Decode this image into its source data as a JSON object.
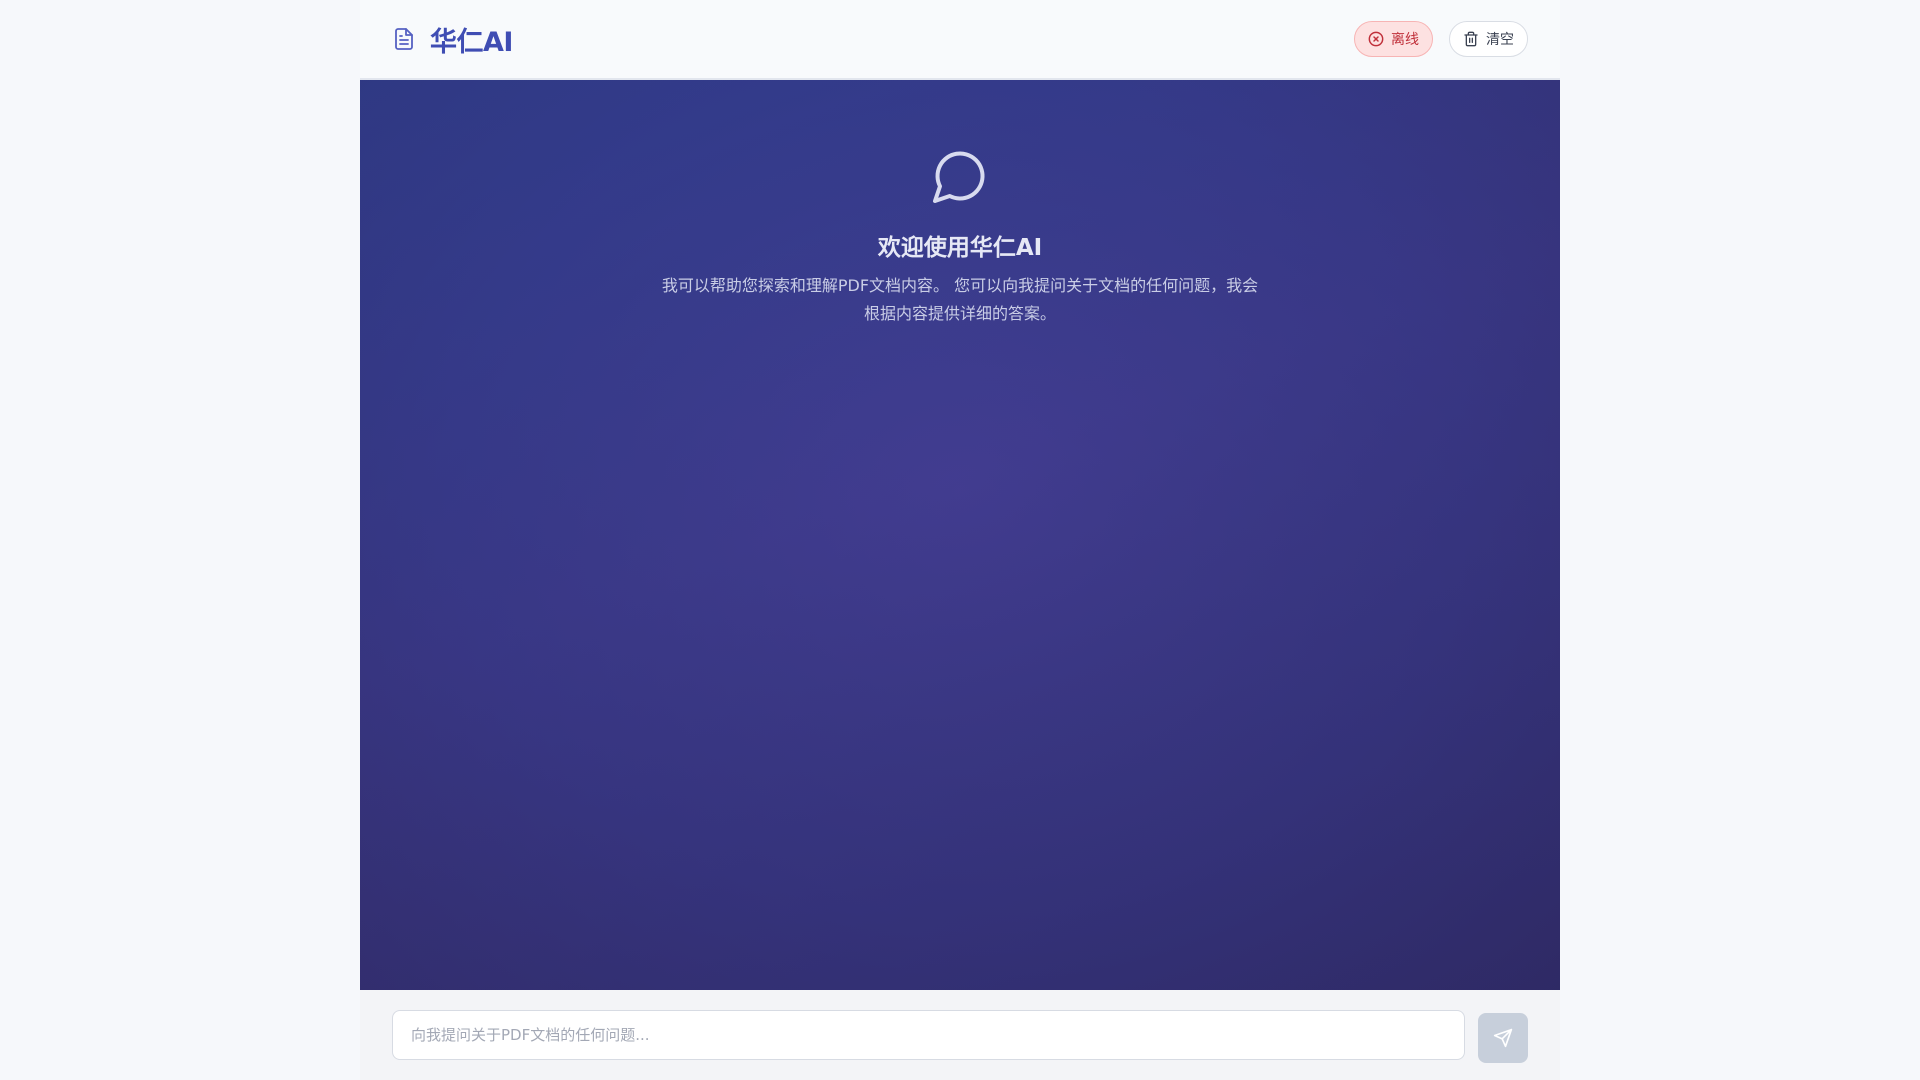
{
  "header": {
    "title": "华仁AI",
    "status_label": "离线",
    "clear_label": "清空"
  },
  "welcome": {
    "title": "欢迎使用华仁AI",
    "description": "我可以帮助您探索和理解PDF文档内容。 您可以向我提问关于文档的任何问题，我会根据内容提供详细的答案。"
  },
  "composer": {
    "placeholder": "向我提问关于PDF文档的任何问题...",
    "value": ""
  },
  "icons": {
    "brand": "file-text-icon",
    "status": "x-circle-icon",
    "clear": "trash-icon",
    "welcome": "message-circle-icon",
    "send": "send-icon"
  },
  "colors": {
    "brand": "#3f4db3",
    "offline": "#c0303a",
    "offline_bg": "#fde1e1",
    "chat_bg": "#383883"
  }
}
